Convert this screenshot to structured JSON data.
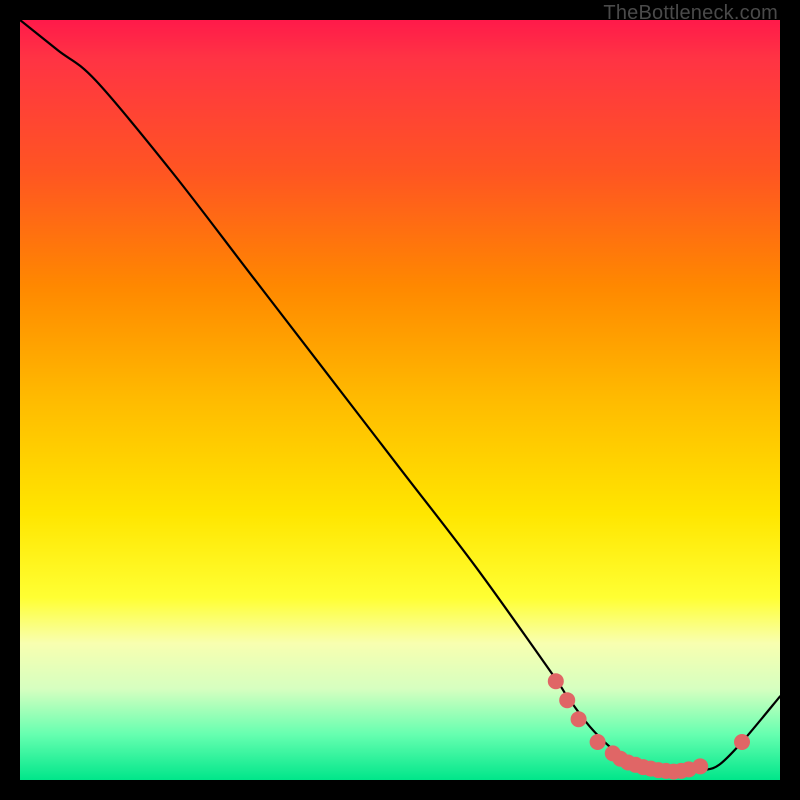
{
  "attribution": "TheBottleneck.com",
  "chart_data": {
    "type": "line",
    "title": "",
    "xlabel": "",
    "ylabel": "",
    "xlim": [
      0,
      100
    ],
    "ylim": [
      0,
      100
    ],
    "grid": false,
    "legend": false,
    "series": [
      {
        "name": "curve",
        "x": [
          0,
          5,
          10,
          20,
          30,
          40,
          50,
          60,
          70,
          72,
          75,
          78,
          80,
          83,
          86,
          88,
          90,
          92,
          95,
          100
        ],
        "y": [
          100,
          96,
          92,
          80,
          67,
          54,
          41,
          28,
          14,
          11,
          7,
          4,
          2.5,
          1.5,
          1,
          1,
          1.3,
          2,
          5,
          11
        ]
      }
    ],
    "markers": [
      {
        "x": 70.5,
        "y": 13
      },
      {
        "x": 72,
        "y": 10.5
      },
      {
        "x": 73.5,
        "y": 8
      },
      {
        "x": 76,
        "y": 5
      },
      {
        "x": 78,
        "y": 3.5
      },
      {
        "x": 79,
        "y": 2.8
      },
      {
        "x": 80,
        "y": 2.3
      },
      {
        "x": 81,
        "y": 2.0
      },
      {
        "x": 82,
        "y": 1.7
      },
      {
        "x": 83,
        "y": 1.5
      },
      {
        "x": 84,
        "y": 1.3
      },
      {
        "x": 85,
        "y": 1.2
      },
      {
        "x": 86,
        "y": 1.1
      },
      {
        "x": 87,
        "y": 1.2
      },
      {
        "x": 88,
        "y": 1.4
      },
      {
        "x": 89.5,
        "y": 1.8
      },
      {
        "x": 95,
        "y": 5
      }
    ],
    "marker_style": {
      "color": "#e06666",
      "radius_px": 8
    }
  }
}
